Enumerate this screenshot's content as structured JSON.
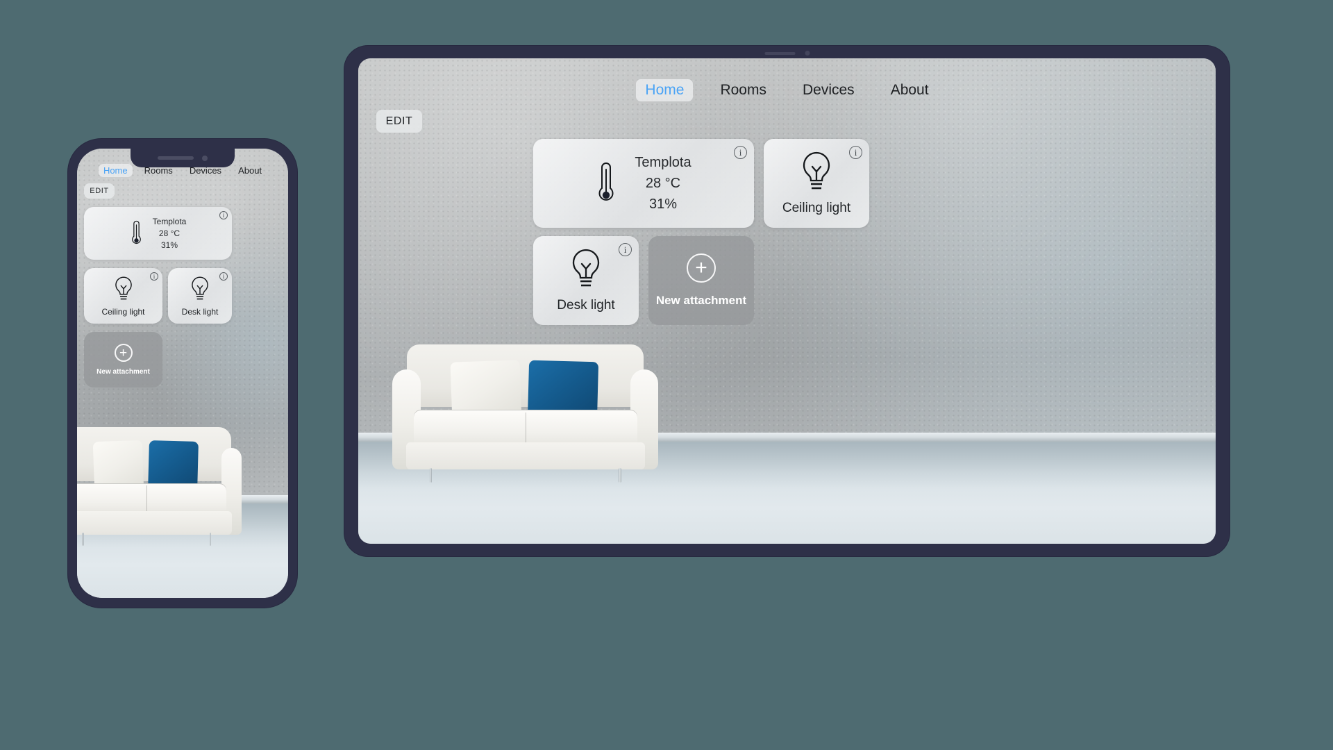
{
  "app": {
    "nav": [
      {
        "label": "Home",
        "active": true
      },
      {
        "label": "Rooms",
        "active": false
      },
      {
        "label": "Devices",
        "active": false
      },
      {
        "label": "About",
        "active": false
      }
    ],
    "edit_button": "EDIT",
    "info_icon_glyph": "i",
    "plus_icon_glyph": "+",
    "accent_color": "#4aa3f5",
    "frame_color": "#2e3048",
    "background_color": "#4e6b71"
  },
  "cards": {
    "temperature": {
      "name": "Templota",
      "temperature": "28 °C",
      "humidity": "31%",
      "icon": "thermometer-icon"
    },
    "ceiling_light": {
      "label": "Ceiling light",
      "icon": "lightbulb-icon"
    },
    "desk_light": {
      "label": "Desk light",
      "icon": "lightbulb-icon"
    },
    "new_attachment": {
      "label": "New attachment",
      "icon": "plus-circle-icon"
    }
  },
  "devices": {
    "phone": {
      "name": "phone-mockup"
    },
    "tablet": {
      "name": "tablet-mockup"
    }
  }
}
